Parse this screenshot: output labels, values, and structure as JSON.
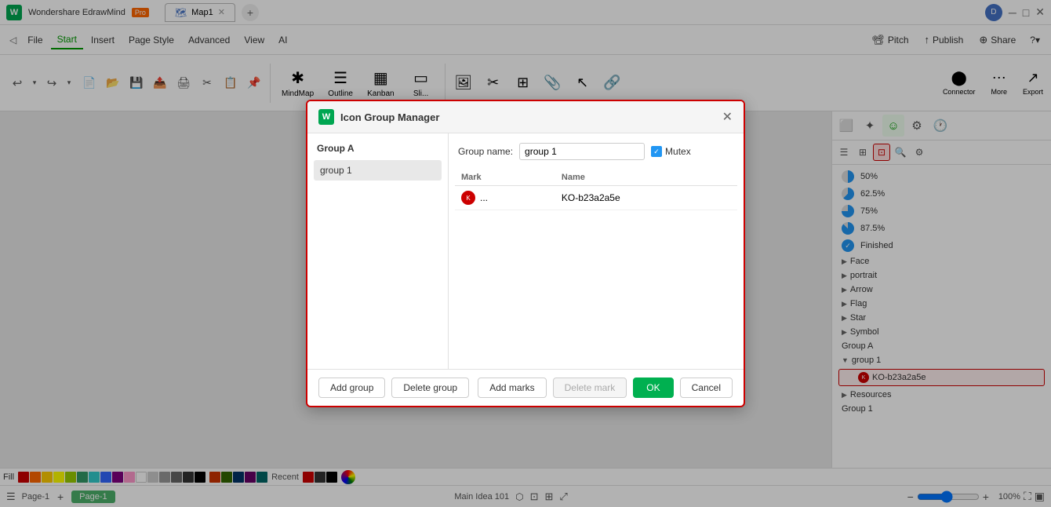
{
  "app": {
    "name": "Wondershare EdrawMind",
    "pro_badge": "Pro",
    "tab_name": "Map1",
    "user_initial": "D"
  },
  "menubar": {
    "items": [
      "File",
      "Start",
      "Insert",
      "Page Style",
      "Advanced",
      "View",
      "AI"
    ],
    "active_item": "Start",
    "right_items": [
      "Pitch",
      "Publish",
      "Share"
    ]
  },
  "ribbon": {
    "tools": [
      {
        "label": "MindMap",
        "icon": "✱"
      },
      {
        "label": "Outline",
        "icon": "☰"
      },
      {
        "label": "Kanban",
        "icon": "▦"
      },
      {
        "label": "Sli...",
        "icon": "▭"
      }
    ]
  },
  "modal": {
    "title": "Icon Group Manager",
    "app_icon": "W",
    "left_header": "Group A",
    "left_items": [
      "group 1"
    ],
    "selected_item": "group 1",
    "group_name_label": "Group name:",
    "group_name_value": "group 1",
    "mutex_label": "Mutex",
    "mutex_checked": true,
    "table": {
      "headers": [
        "Mark",
        "Name"
      ],
      "rows": [
        {
          "mark_text": "...",
          "name": "KO-b23a2a5e"
        }
      ]
    },
    "buttons": {
      "add_group": "Add group",
      "delete_group": "Delete group",
      "add_marks": "Add marks",
      "delete_mark": "Delete mark",
      "ok": "OK",
      "cancel": "Cancel"
    }
  },
  "right_panel": {
    "progress_items": [
      {
        "label": "50%",
        "type": "pie50"
      },
      {
        "label": "62.5%",
        "type": "pie625"
      },
      {
        "label": "75%",
        "type": "pie75"
      },
      {
        "label": "87.5%",
        "type": "pie875"
      },
      {
        "label": "Finished",
        "type": "check"
      }
    ],
    "tree_items": [
      {
        "label": "Face",
        "expandable": true
      },
      {
        "label": "portrait",
        "expandable": true
      },
      {
        "label": "Arrow",
        "expandable": true
      },
      {
        "label": "Flag",
        "expandable": true
      },
      {
        "label": "Star",
        "expandable": true
      },
      {
        "label": "Symbol",
        "expandable": true
      },
      {
        "label": "Group A",
        "expandable": false
      },
      {
        "label": "group 1",
        "expandable": true,
        "expanded": true
      },
      {
        "label": "KO-b23a2a5e",
        "is_sub": true,
        "highlighted": true
      },
      {
        "label": "Resources",
        "expandable": true
      },
      {
        "label": "Group 1",
        "expandable": false
      }
    ]
  },
  "statusbar": {
    "main_idea": "Main Idea 101",
    "page_label": "Page-1",
    "active_page": "Page-1",
    "zoom": "100%"
  },
  "colorbar": {
    "fill_label": "Fill",
    "colors": [
      "#cc0000",
      "#ff6600",
      "#ffcc00",
      "#ffff00",
      "#99cc00",
      "#339966",
      "#33cccc",
      "#3366ff",
      "#800080",
      "#ff99cc",
      "#ffffff",
      "#cccccc",
      "#999999",
      "#666666",
      "#333333",
      "#000000"
    ]
  }
}
